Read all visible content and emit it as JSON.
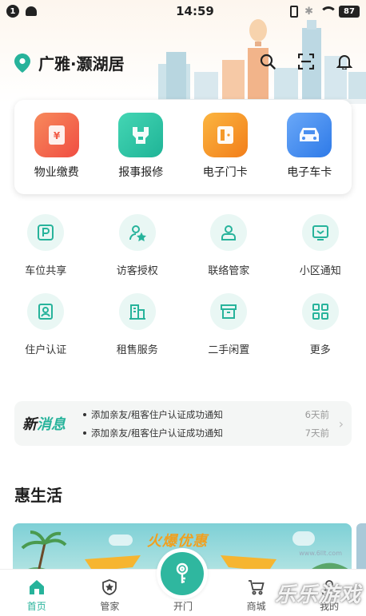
{
  "status_bar": {
    "notification_count": "1",
    "time": "14:59",
    "battery": "87"
  },
  "header": {
    "location": "广雅·灏湖居",
    "icons": [
      "search-icon",
      "scan-icon",
      "bell-icon"
    ]
  },
  "main_services": [
    {
      "label": "物业缴费",
      "icon": "property-fee-icon",
      "color": "#f46a4c"
    },
    {
      "label": "报事报修",
      "icon": "repair-icon",
      "color": "#2ec4a5"
    },
    {
      "label": "电子门卡",
      "icon": "door-card-icon",
      "color": "#f49a28"
    },
    {
      "label": "电子车卡",
      "icon": "car-card-icon",
      "color": "#3f8ef2"
    }
  ],
  "grid": {
    "row1": [
      {
        "label": "车位共享",
        "icon": "parking-icon"
      },
      {
        "label": "访客授权",
        "icon": "visitor-icon"
      },
      {
        "label": "联络管家",
        "icon": "butler-icon"
      },
      {
        "label": "小区通知",
        "icon": "notice-icon"
      }
    ],
    "row2": [
      {
        "label": "住户认证",
        "icon": "resident-id-icon"
      },
      {
        "label": "租售服务",
        "icon": "rental-icon"
      },
      {
        "label": "二手闲置",
        "icon": "secondhand-icon"
      },
      {
        "label": "更多",
        "icon": "more-grid-icon"
      }
    ]
  },
  "news": {
    "title_part1": "新",
    "title_part2": "消息",
    "items": [
      {
        "text": "添加亲友/租客住户认证成功通知",
        "time": "6天前"
      },
      {
        "text": "添加亲友/租客住户认证成功通知",
        "time": "7天前"
      }
    ]
  },
  "section": {
    "title": "惠生活"
  },
  "banner": {
    "title": "火爆优惠"
  },
  "bottom_nav": {
    "items": [
      {
        "label": "首页",
        "icon": "home-icon",
        "active": true
      },
      {
        "label": "管家",
        "icon": "butler-badge-icon",
        "active": false
      },
      {
        "label": "开门",
        "icon": "key-icon",
        "active": false
      },
      {
        "label": "商城",
        "icon": "cart-icon",
        "active": false
      },
      {
        "label": "我的",
        "icon": "profile-icon",
        "active": false
      }
    ]
  },
  "watermark": {
    "text": "乐乐游戏",
    "url": "www.6llt.com"
  },
  "colors": {
    "accent": "#27b39b",
    "icon_bg": "#e9f7f4"
  }
}
